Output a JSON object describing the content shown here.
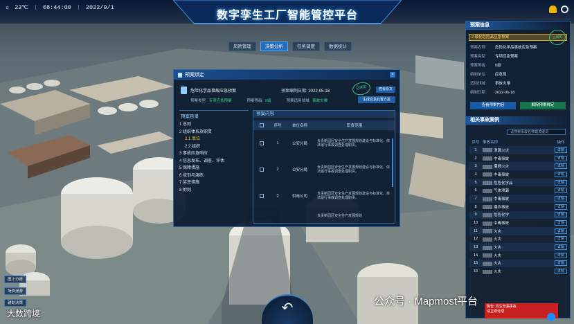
{
  "status": {
    "temperature": "23℃",
    "time": "08:44:00",
    "date": "2022/9/1"
  },
  "app": {
    "title": "数字孪生工厂智能管控平台"
  },
  "tabs": [
    "风险管理",
    "决策分析",
    "任务调度",
    "数据统计"
  ],
  "modal": {
    "title": "预案绑定",
    "close_label": "×",
    "plan_name": "危险化学品事故应急预案",
    "date_label": "预案编制日期:",
    "date_value": "2022-05-18",
    "stamp_text": "已绑定",
    "view_button": "查看原文",
    "type_label": "预案类型:",
    "type_value": "专项应急预案",
    "level_label": "预案等级:",
    "level_value": "II级",
    "scope_label": "预案适用领域:",
    "scope_value": "事故灾难",
    "generate_button": "生成应急处置方案",
    "toc_title": "预案目录",
    "toc": [
      {
        "label": "1 总则",
        "sub": false,
        "active": false
      },
      {
        "label": "2 组织体系及职责",
        "sub": false,
        "active": false
      },
      {
        "label": "2.1 单位",
        "sub": true,
        "active": true
      },
      {
        "label": "2.2 组织",
        "sub": true,
        "active": false
      },
      {
        "label": "3 事故应急响应",
        "sub": false,
        "active": false
      },
      {
        "label": "4 信息发布、调查、评估",
        "sub": false,
        "active": false
      },
      {
        "label": "5 保障措施",
        "sub": false,
        "active": false
      },
      {
        "label": "6 培训与演练",
        "sub": false,
        "active": false
      },
      {
        "label": "7 奖惩措施",
        "sub": false,
        "active": false
      },
      {
        "label": "8 附则",
        "sub": false,
        "active": false
      }
    ],
    "content_title": "预案内容",
    "columns": [
      "序号",
      "单位名称",
      "职责范围"
    ],
    "rows": [
      {
        "no": "1",
        "unit": "公安分局",
        "duty": "负责新园区安全生产发展规划建设与标准化，依法履行事故调查处理职责。"
      },
      {
        "no": "2",
        "unit": "公安分局",
        "duty": "负责新园区安全生产发展规划建设与标准化，依法履行事故调查处理职责。"
      },
      {
        "no": "3",
        "unit": "供电公司",
        "duty": "负责新园区安全生产发展规划建设与标准化，依法履行事故调查处理职责。"
      }
    ],
    "extra_duty": "负责新园区安全生产发展规划"
  },
  "right": {
    "plan_section": "预案信息",
    "alarm": "2 级化危险品应急预案",
    "stamp": "已绑定",
    "fields": [
      {
        "k": "预案名称",
        "v": "危险化学品事故应急预案"
      },
      {
        "k": "预案类型",
        "v": "专项应急预案"
      },
      {
        "k": "预案等级",
        "v": "II级"
      },
      {
        "k": "编制单位",
        "v": "应急局"
      },
      {
        "k": "适用领域",
        "v": "事故灾难"
      },
      {
        "k": "编制日期",
        "v": "2022-05-18"
      }
    ],
    "btn_view": "查看预案内容",
    "btn_unbind": "解除预案绑定",
    "case_section": "相关事故案例",
    "search_placeholder": "请搜索事故名称或关键词",
    "case_cols": [
      "序号",
      "事故名称",
      "操作"
    ],
    "cases": [
      {
        "no": "1",
        "name": "泄漏火灾",
        "op": "详情"
      },
      {
        "no": "2",
        "name": "中毒事故",
        "op": "详情"
      },
      {
        "no": "3",
        "name": "爆燃火灾",
        "op": "详情"
      },
      {
        "no": "4",
        "name": "中毒事故",
        "op": "详情"
      },
      {
        "no": "5",
        "name": "危险化学品",
        "op": "详情"
      },
      {
        "no": "6",
        "name": "气体泄漏",
        "op": "详情"
      },
      {
        "no": "7",
        "name": "中毒事故",
        "op": "详情"
      },
      {
        "no": "8",
        "name": "爆炸事故",
        "op": "详情"
      },
      {
        "no": "9",
        "name": "危险化学",
        "op": "详情"
      },
      {
        "no": "10",
        "name": "中毒事故",
        "op": "详情"
      },
      {
        "no": "11",
        "name": "火灾",
        "op": "详情"
      },
      {
        "no": "12",
        "name": "火灾",
        "op": "详情"
      },
      {
        "no": "13",
        "name": "火灾",
        "op": "详情"
      },
      {
        "no": "14",
        "name": "火灾",
        "op": "详情"
      },
      {
        "no": "15",
        "name": "火灾",
        "op": "详情"
      },
      {
        "no": "16",
        "name": "火灾",
        "op": "详情"
      }
    ]
  },
  "left_buttons": [
    "图上分析",
    "场景漫游",
    "辅助决策"
  ],
  "back_icon": "↶",
  "watermark_left": "大数跨境",
  "watermark_right": "公众号 · Mapmost平台",
  "toast": {
    "line1": "警告: 发生泄漏事故",
    "line2": "请立即处理"
  }
}
